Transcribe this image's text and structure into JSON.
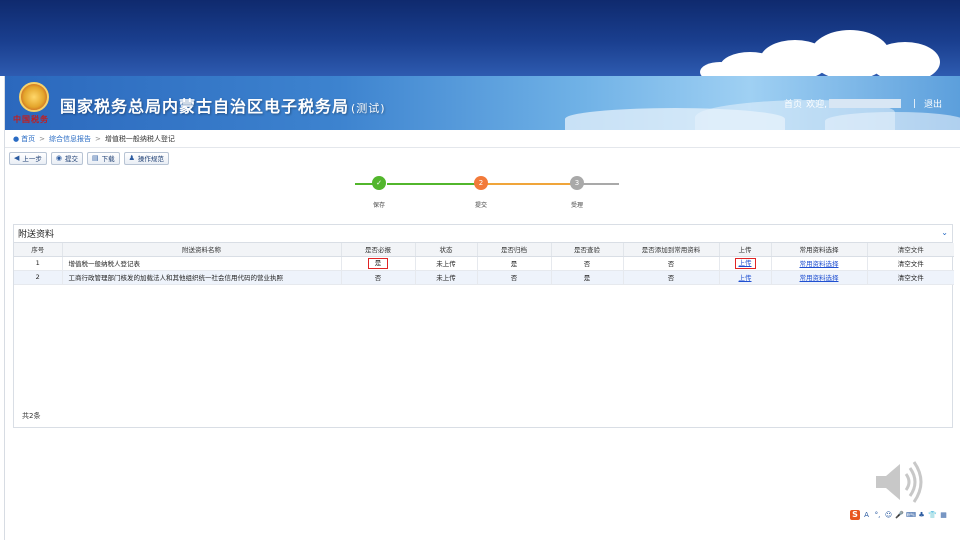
{
  "header": {
    "title": "国家税务总局内蒙古自治区电子税务局",
    "title_suffix": "(测试)",
    "emblem_text": "中国税务",
    "home": "首页",
    "welcome": "欢迎,",
    "separator": "|",
    "logout": "退出"
  },
  "breadcrumb": {
    "home": "首页",
    "sep": ">",
    "level1": "综合信息报告",
    "level2": "增值税一般纳税人登记"
  },
  "toolbar": {
    "prev": "上一步",
    "submit": "提交",
    "download": "下载",
    "guide": "操作规范"
  },
  "steps": [
    {
      "label": "保存",
      "number": "✓",
      "state": "done",
      "color": "#52b62c"
    },
    {
      "label": "提交",
      "number": "2",
      "state": "current",
      "color": "#f27a3a"
    },
    {
      "label": "受理",
      "number": "3",
      "state": "pending",
      "color": "#a9a9a9"
    }
  ],
  "section": {
    "title": "附送资料",
    "columns": [
      "序号",
      "附送资料名称",
      "是否必报",
      "状态",
      "是否归档",
      "是否查验",
      "是否添加到常用资料",
      "上传",
      "常用资料选择",
      "清空文件"
    ],
    "rows": [
      {
        "no": "1",
        "name": "增值税一般纳税人登记表",
        "required": "是",
        "status": "未上传",
        "archived": "是",
        "verified": "否",
        "add_common": "否",
        "upload": "上传",
        "select_common": "常用资料选择",
        "clear": "清空文件"
      },
      {
        "no": "2",
        "name": "工商行政管理部门核发的加载法人和其他组织统一社会信用代码的营业执照",
        "required": "否",
        "status": "未上传",
        "archived": "否",
        "verified": "是",
        "add_common": "否",
        "upload": "上传",
        "select_common": "常用资料选择",
        "clear": "清空文件"
      }
    ],
    "total": "共2条"
  },
  "colors": {
    "accent": "#2a6cc4",
    "highlight": "#e02424",
    "link": "#1f4fd1"
  },
  "ime": {
    "logo": "S",
    "icons": [
      "A",
      "°,",
      "☺",
      "🎤",
      "⌨",
      "♣",
      "👕",
      "▦"
    ]
  }
}
